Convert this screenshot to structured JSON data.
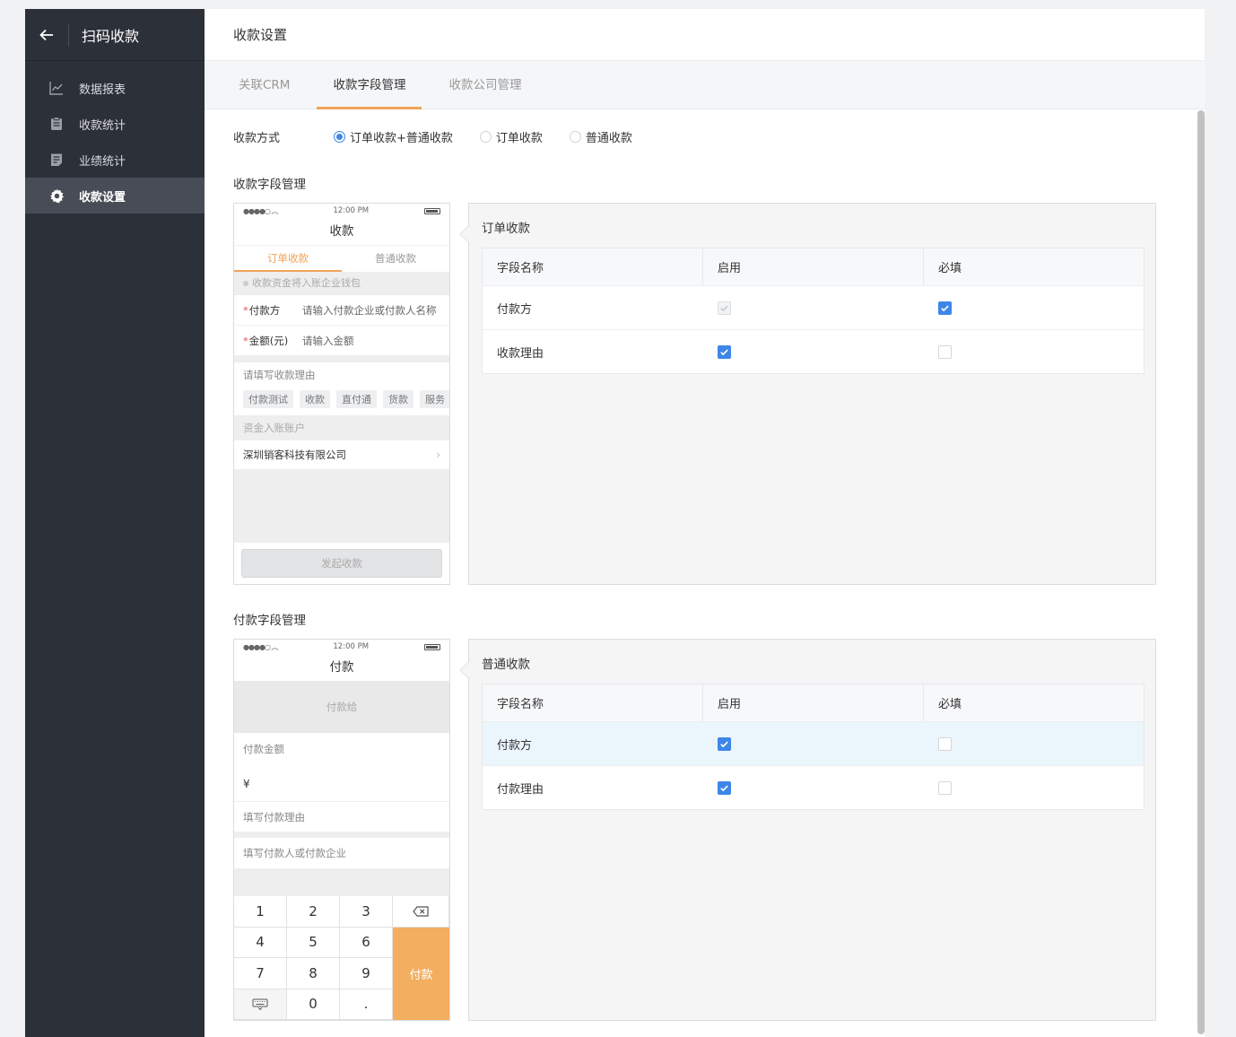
{
  "sidebar": {
    "title": "扫码收款",
    "items": [
      {
        "label": "数据报表",
        "icon": "chart-line-icon"
      },
      {
        "label": "收款统计",
        "icon": "document-icon"
      },
      {
        "label": "业绩统计",
        "icon": "list-doc-icon"
      },
      {
        "label": "收款设置",
        "icon": "gear-icon",
        "active": true
      }
    ]
  },
  "header": {
    "title": "收款设置"
  },
  "tabs": [
    {
      "label": "关联CRM",
      "active": false
    },
    {
      "label": "收款字段管理",
      "active": true
    },
    {
      "label": "收款公司管理",
      "active": false
    }
  ],
  "mode": {
    "label": "收款方式",
    "options": [
      {
        "label": "订单收款+普通收款",
        "selected": true
      },
      {
        "label": "订单收款",
        "selected": false
      },
      {
        "label": "普通收款",
        "selected": false
      }
    ]
  },
  "collect": {
    "section_title": "收款字段管理",
    "phone": {
      "time": "12:00 PM",
      "title": "收款",
      "tab_order": "订单收款",
      "tab_normal": "普通收款",
      "note": "收款资金将入账企业钱包",
      "payer_label": "付款方",
      "payer_placeholder": "请输入付款企业或付款人名称",
      "amount_label": "金额(元)",
      "amount_placeholder": "请输入金额",
      "reason_title": "请填写收款理由",
      "chips": [
        "付款测试",
        "收款",
        "直付通",
        "货款",
        "服务"
      ],
      "account_title": "资金入账账户",
      "account_value": "深圳销客科技有限公司",
      "submit": "发起收款"
    },
    "panel": {
      "title": "订单收款",
      "headers": [
        "字段名称",
        "启用",
        "必填"
      ],
      "rows": [
        {
          "name": "付款方",
          "enabled": "disabled-checked",
          "required": "checked"
        },
        {
          "name": "收款理由",
          "enabled": "checked",
          "required": "unchecked"
        }
      ]
    }
  },
  "pay": {
    "section_title": "付款字段管理",
    "phone": {
      "time": "12:00 PM",
      "title": "付款",
      "pay_to": "付款给",
      "amount_label": "付款金额",
      "yen": "¥",
      "reason": "填写付款理由",
      "payer": "填写付款人或付款企业",
      "keys": [
        "1",
        "2",
        "3",
        "4",
        "5",
        "6",
        "7",
        "8",
        "9",
        "0",
        "."
      ],
      "pay_key": "付款"
    },
    "panel": {
      "title": "普通收款",
      "headers": [
        "字段名称",
        "启用",
        "必填"
      ],
      "rows": [
        {
          "name": "付款方",
          "enabled": "checked",
          "required": "unchecked",
          "highlight": true
        },
        {
          "name": "付款理由",
          "enabled": "checked",
          "required": "unchecked"
        }
      ]
    }
  },
  "colors": {
    "accent": "#3e86e8",
    "orange": "#f0a35a",
    "sidebar_bg": "#2c3039"
  }
}
